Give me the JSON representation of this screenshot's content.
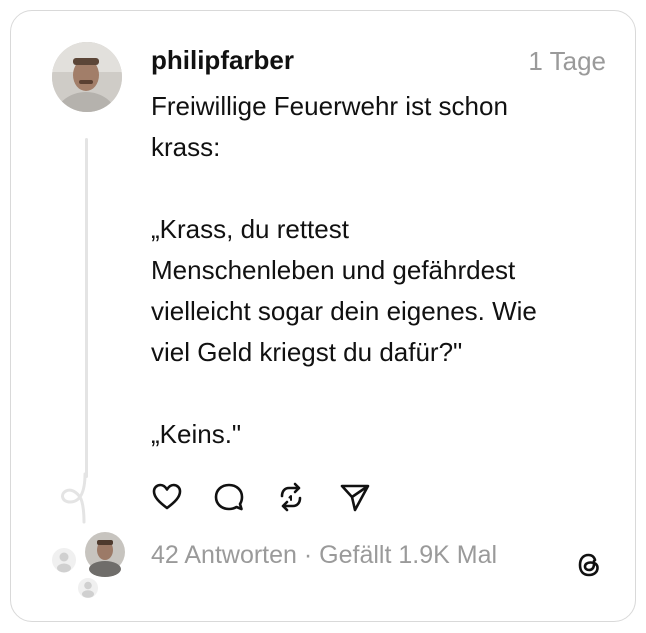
{
  "post": {
    "username": "philipfarber",
    "time": "1 Tage",
    "text": "Freiwillige Feuerwehr ist schon\nkrass:\n\n„Krass, du rettest\nMenschenleben und gefährdest\nvielleicht sogar dein eigenes. Wie\nviel Geld kriegst du dafür?\"\n\n„Keins.\""
  },
  "actions": [
    {
      "name": "like",
      "icon": "heart-icon"
    },
    {
      "name": "reply",
      "icon": "comment-bubble-icon"
    },
    {
      "name": "repost",
      "icon": "repost-icon"
    },
    {
      "name": "share",
      "icon": "send-icon"
    }
  ],
  "stats": {
    "replies": "42 Antworten",
    "separator": "·",
    "likes": "Gefällt 1.9K Mal"
  },
  "colors": {
    "text": "#111111",
    "muted": "#9a9a9a",
    "border": "#d9d9d9"
  }
}
